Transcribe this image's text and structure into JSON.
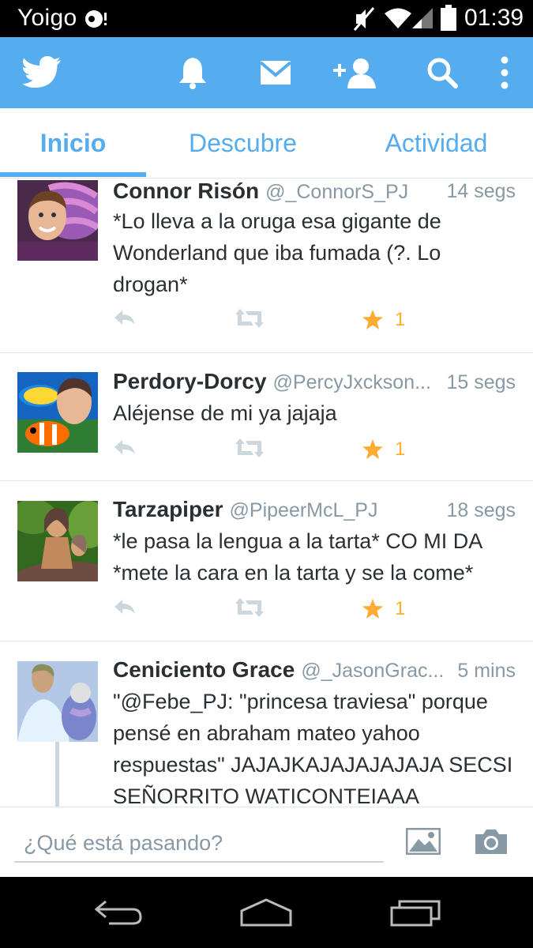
{
  "status_bar": {
    "carrier": "Yoigo",
    "time": "01:39",
    "icons": [
      "carrier-notification-icon",
      "mute-icon",
      "wifi-icon",
      "signal-icon",
      "battery-icon"
    ]
  },
  "toolbar": {
    "icons": [
      "twitter-bird-icon",
      "notifications-bell-icon",
      "messages-envelope-icon",
      "add-user-icon",
      "search-icon",
      "overflow-menu-icon"
    ],
    "background": "#55acee"
  },
  "tabs": [
    {
      "label": "Inicio",
      "active": true
    },
    {
      "label": "Descubre",
      "active": false
    },
    {
      "label": "Actividad",
      "active": false
    }
  ],
  "tweets": [
    {
      "name": "Connor Risón",
      "handle": "@_ConnorS_PJ",
      "time": "14 segs",
      "text": "*Lo lleva a la oruga esa gigante de Wonderland que iba fumada (?. Lo drogan*",
      "favorites": "1"
    },
    {
      "name": "Perdory-Dorcy",
      "handle": "@PercyJxckson...",
      "time": "15 segs",
      "text": "Aléjense de mi ya jajaja",
      "favorites": "1"
    },
    {
      "name": "Tarzapiper",
      "handle": "@PipeerMcL_PJ",
      "time": "18 segs",
      "text": "*le pasa la lengua a la tarta* CO MI DA *mete la cara en la tarta y se la come*",
      "favorites": "1"
    },
    {
      "name": "Ceniciento Grace",
      "handle": "@_JasonGrac...",
      "time": "5 mins",
      "text": "\"@Febe_PJ: \"princesa traviesa\" porque pensé en abraham mateo yahoo respuestas\" JAJAJKAJAJAJAJAJA SECSI SEÑORRITO WATICONTEIAAA",
      "favorites": ""
    }
  ],
  "compose": {
    "placeholder": "¿Qué está pasando?"
  },
  "colors": {
    "accent": "#55acee",
    "favorite": "#ffac33",
    "muted_text": "#8899a6",
    "body_text": "#292f33"
  }
}
